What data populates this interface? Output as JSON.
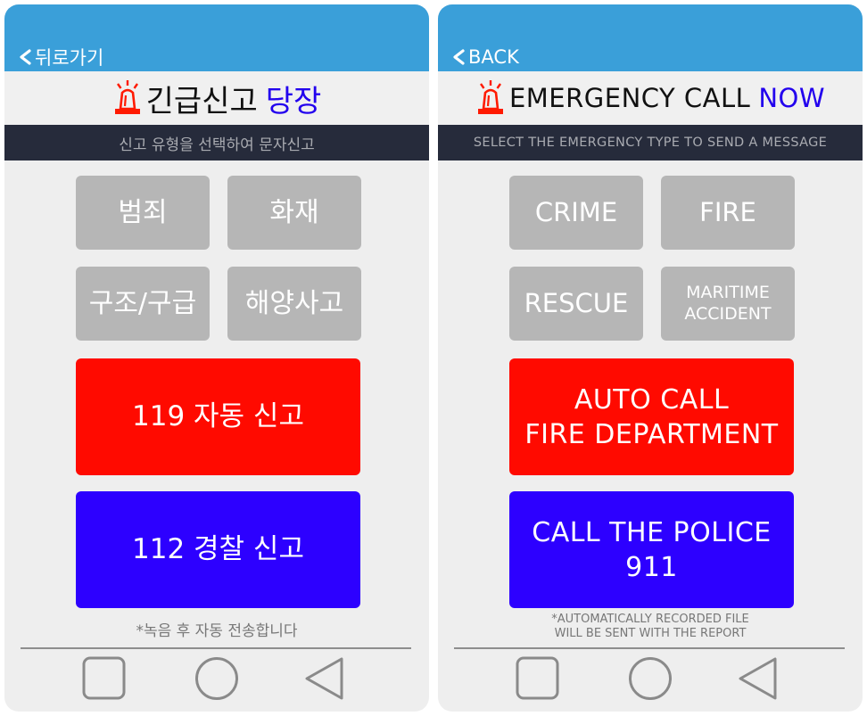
{
  "korean": {
    "back_label": "뒤로가기",
    "title_main": "긴급신고",
    "title_accent": "당장",
    "subtitle": "신고 유형을 선택하여 문자신고",
    "buttons": [
      "범죄",
      "화재",
      "구조/구급",
      "해양사고"
    ],
    "auto_call": "119 자동 신고",
    "police_call": "112 경찰 신고",
    "note": "*녹음 후 자동 전송합니다"
  },
  "english": {
    "back_label": "BACK",
    "title_main": "EMERGENCY CALL",
    "title_accent": "NOW",
    "subtitle": "SELECT THE EMERGENCY TYPE TO SEND A MESSAGE",
    "buttons": [
      "CRIME",
      "FIRE",
      "RESCUE",
      "MARITIME\nACCIDENT"
    ],
    "auto_call": "AUTO CALL\nFIRE DEPARTMENT",
    "police_call": "CALL THE POLICE\n911",
    "note": "*AUTOMATICALLY RECORDED FILE\nWILL BE SENT WITH THE REPORT"
  },
  "nav_icons": [
    "recent-apps-icon",
    "home-icon",
    "back-triangle-icon"
  ],
  "colors": {
    "header_blue": "#3a9fd9",
    "accent_blue": "#2200ee",
    "fire_red": "#ff0a00",
    "police_blue": "#2d00ff",
    "category_gray": "#b6b6b6",
    "subtitle_bar": "#262b3b"
  }
}
